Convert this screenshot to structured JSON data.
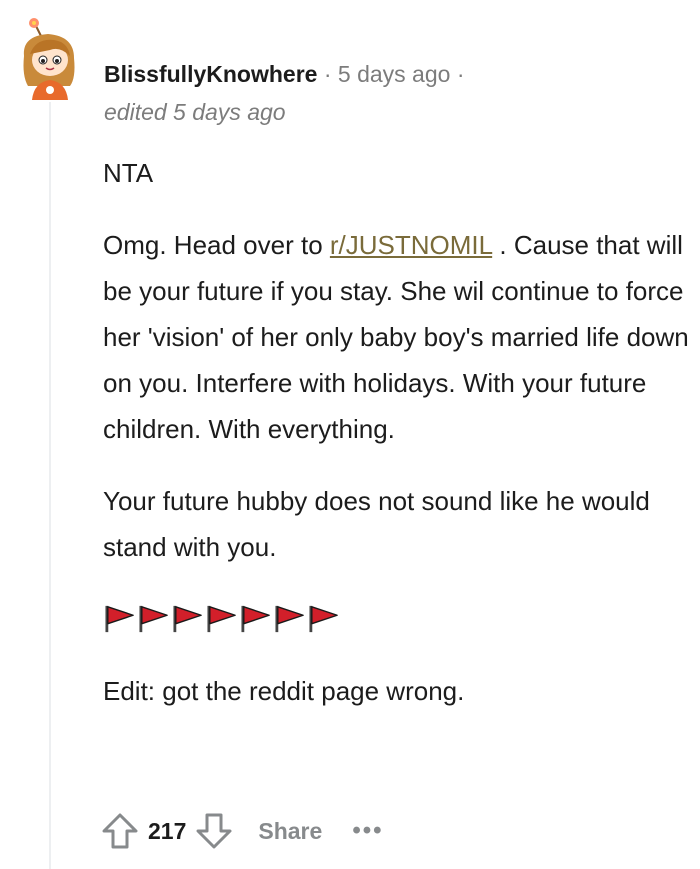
{
  "comment": {
    "author": "BlissfullyKnowhere",
    "separator": "·",
    "timestamp": "5 days ago",
    "trailing_separator": "·",
    "edited": "edited 5 days ago",
    "body": {
      "line1": "NTA",
      "p2_before_link": "Omg. Head over to ",
      "p2_link": "r/JUSTNOMIL",
      "p2_after_link": " . Cause that will be your future if you stay. She wil continue to force her 'vision' of her only baby boy's married life down on you. Interfere with holidays. With your future children. With everything.",
      "p3": "Your future hubby does not sound like he would stand with you.",
      "flag_count": 7,
      "p5": "Edit: got the reddit page wrong."
    },
    "actions": {
      "vote_count": "217",
      "share_label": "Share",
      "more_label": "•••"
    }
  },
  "colors": {
    "flag_red": "#d21f2a",
    "link": "#7a6b3a",
    "muted": "#7c7c7c"
  },
  "icons": {
    "avatar": "reddit-snoo-avatar",
    "upvote": "arrow-up-icon",
    "downvote": "arrow-down-icon",
    "flag": "red-flag-emoji"
  }
}
